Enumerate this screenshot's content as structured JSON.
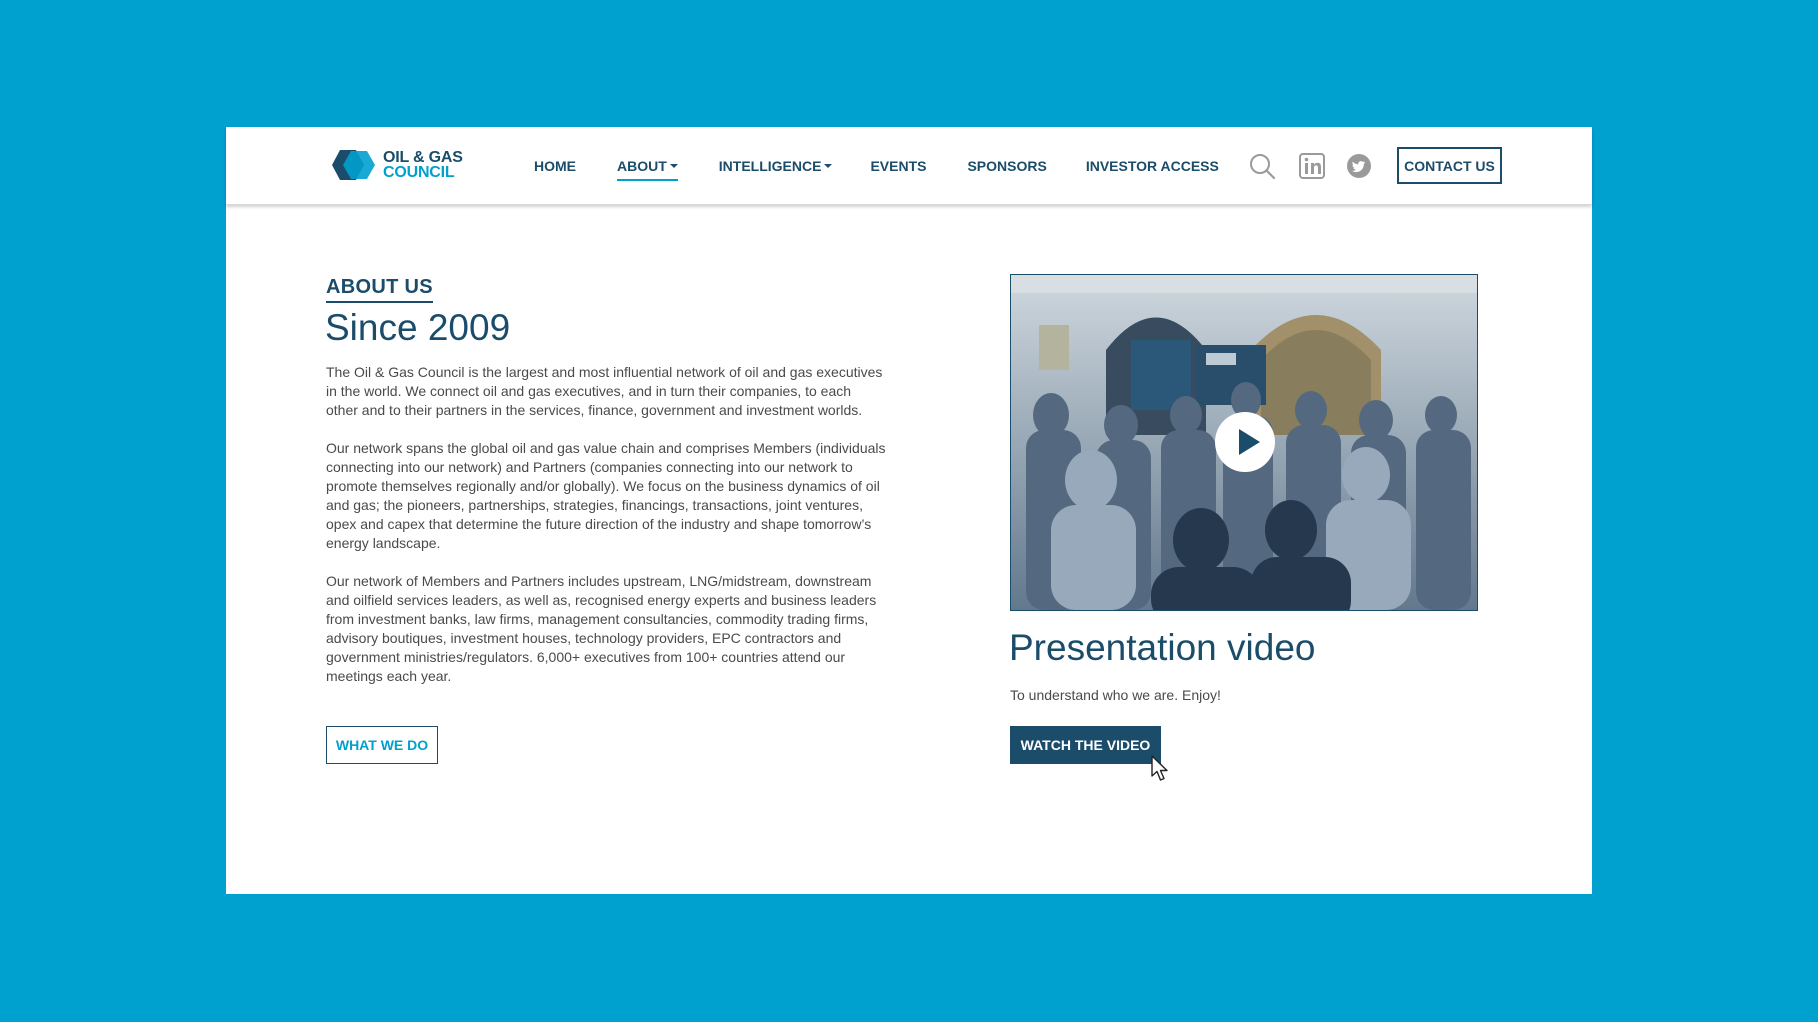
{
  "colors": {
    "backdrop": "#00a0cf",
    "brand_dark": "#1b4d6b",
    "brand_accent": "#00a0cf",
    "body_text": "#4a4a4a"
  },
  "logo": {
    "line1": "OIL & GAS",
    "line2": "COUNCIL"
  },
  "nav": {
    "items": [
      {
        "label": "HOME",
        "dropdown": false,
        "active": false
      },
      {
        "label": "ABOUT",
        "dropdown": true,
        "active": true
      },
      {
        "label": "INTELLIGENCE",
        "dropdown": true,
        "active": false
      },
      {
        "label": "EVENTS",
        "dropdown": false,
        "active": false
      },
      {
        "label": "SPONSORS",
        "dropdown": false,
        "active": false
      },
      {
        "label": "INVESTOR ACCESS",
        "dropdown": false,
        "active": false
      }
    ],
    "icons": [
      "search-icon",
      "linkedin-icon",
      "twitter-icon"
    ],
    "contact_label": "CONTACT US"
  },
  "about": {
    "eyebrow": "ABOUT US",
    "title": "Since 2009",
    "paragraphs": [
      "The Oil & Gas Council is the largest and most influential network of oil and gas executives in the world. We connect oil and gas executives, and in turn their companies, to each other and to their partners in the services, finance, government and investment worlds.",
      "Our network spans the global oil and gas value chain and comprises Members (individuals connecting into our network) and Partners (companies connecting into our network to promote themselves regionally and/or globally). We focus on the business dynamics of oil and gas; the pioneers, partnerships, strategies, financings, transactions, joint ventures, opex and capex that determine the future direction of the industry and shape tomorrow’s energy landscape.",
      "Our network of Members and Partners includes upstream, LNG/midstream, downstream and oilfield services leaders, as well as, recognised energy experts and business leaders from investment banks, law firms, management consultancies, commodity trading firms, advisory boutiques, investment houses, technology providers, EPC contractors and government ministries/regulators. 6,000+ executives from 100+ countries attend our meetings each year."
    ],
    "button_label": "WHAT WE DO"
  },
  "video": {
    "title": "Presentation video",
    "subtitle": "To understand who we are. Enjoy!",
    "button_label": "WATCH THE VIDEO"
  }
}
